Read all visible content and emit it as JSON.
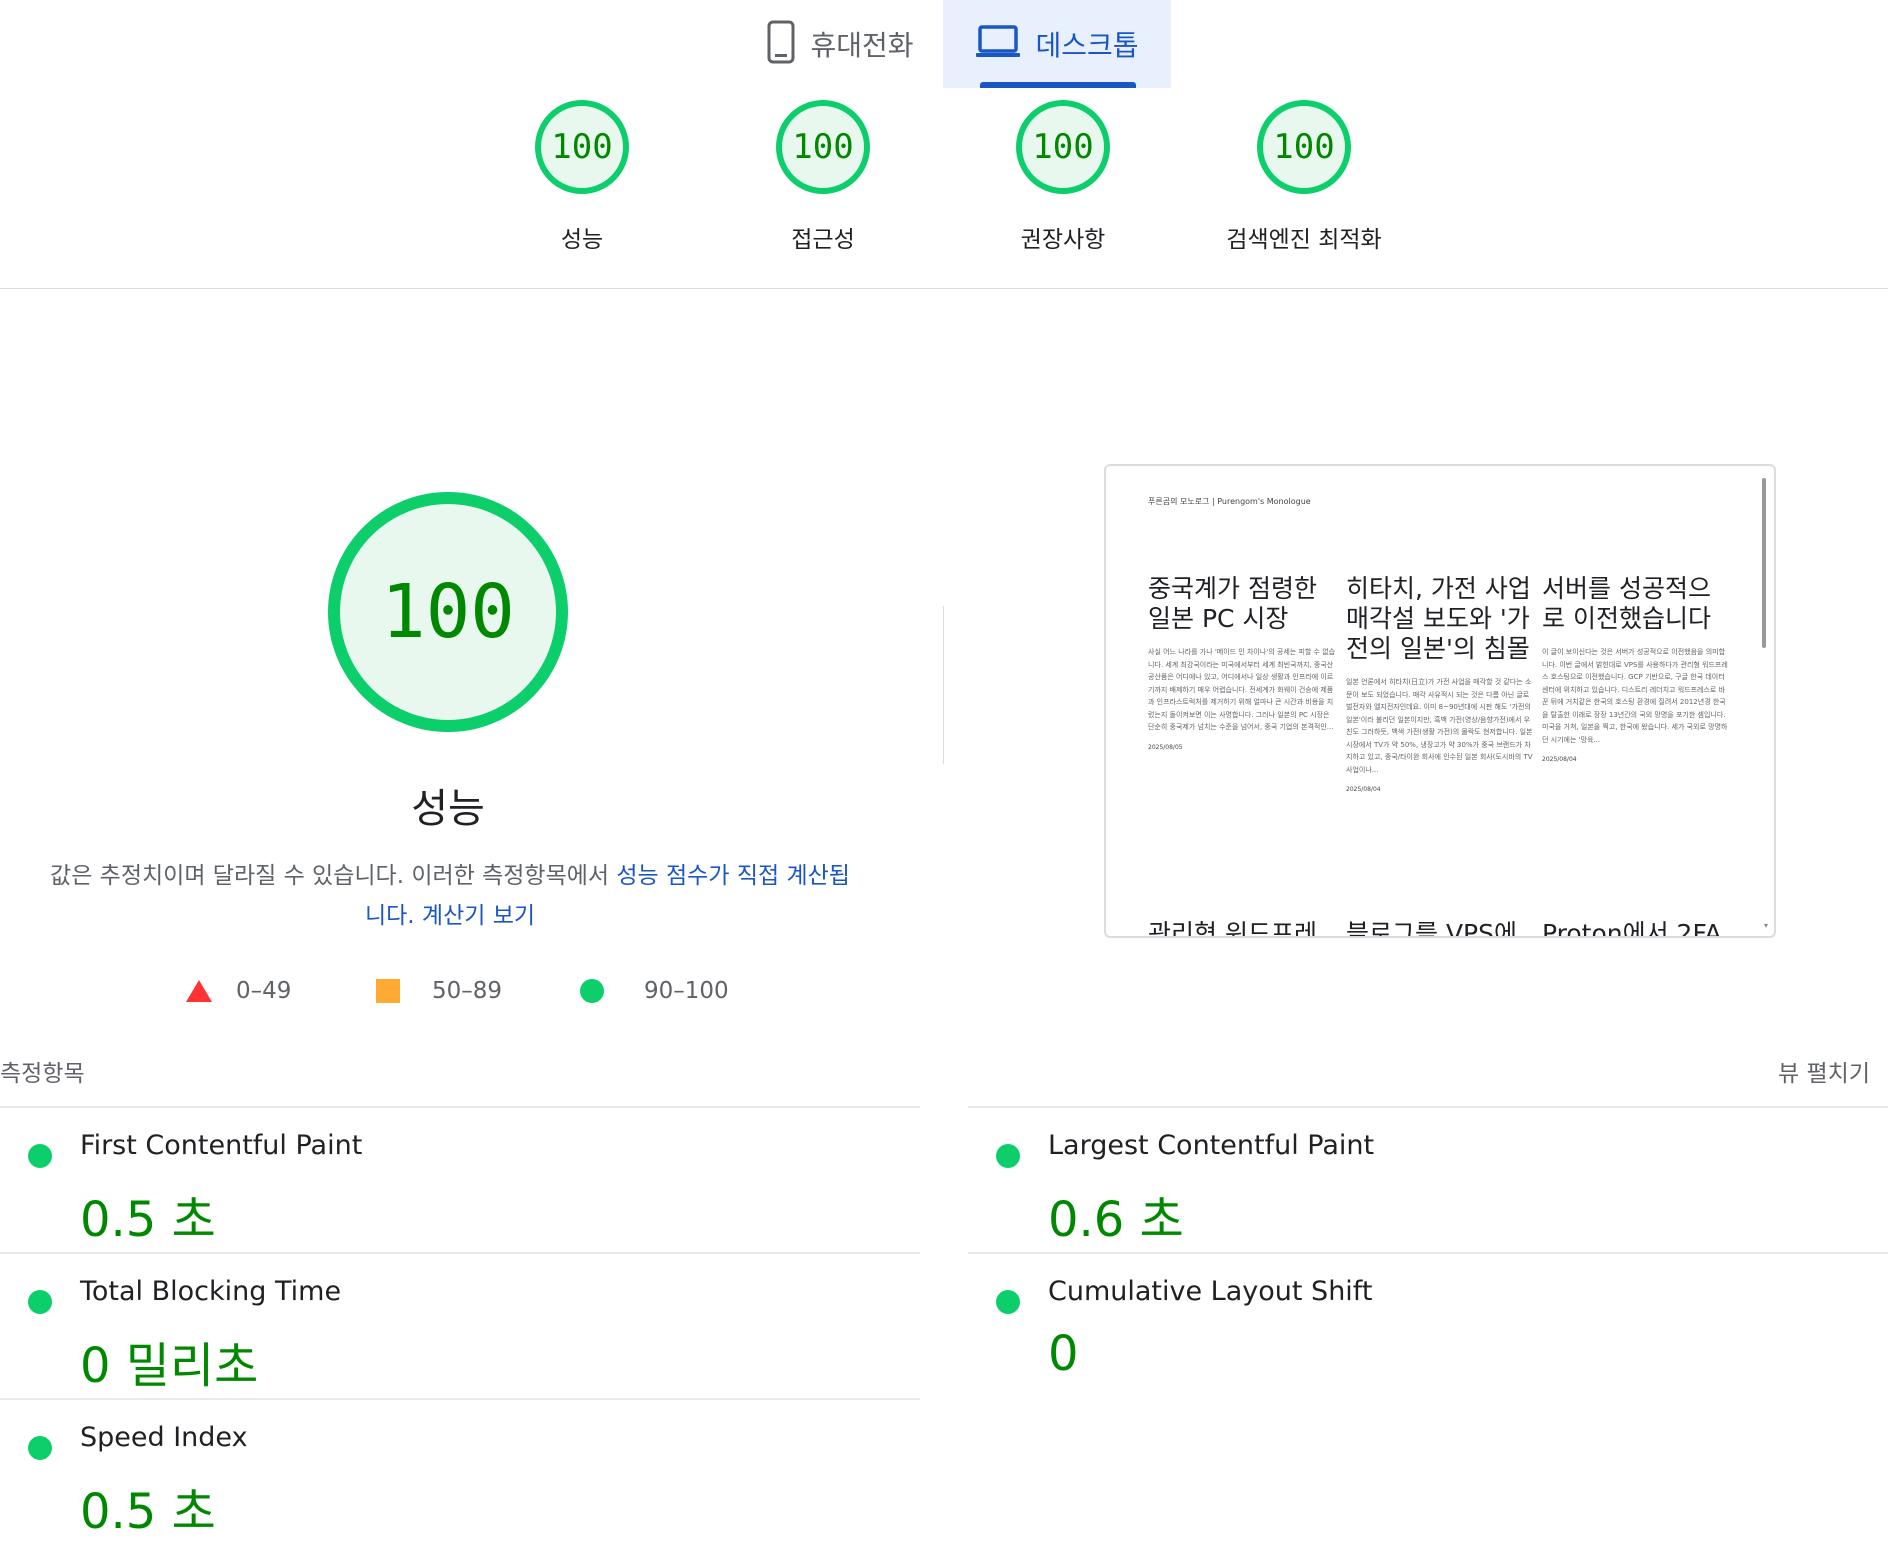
{
  "tabs": [
    {
      "label": "휴대전화",
      "icon": "phone-icon",
      "selected": false
    },
    {
      "label": "데스크톱",
      "icon": "laptop-icon",
      "selected": true
    }
  ],
  "scores": [
    {
      "label": "성능",
      "value": "100"
    },
    {
      "label": "접근성",
      "value": "100"
    },
    {
      "label": "권장사항",
      "value": "100"
    },
    {
      "label": "검색엔진 최적화",
      "value": "100"
    }
  ],
  "performance": {
    "score": "100",
    "title": "성능",
    "desc_prefix": "값은 추정치이며 달라질 수 있습니다. 이러한 측정항목에서 ",
    "desc_link1": "성능 점수가 직접 계산됩니다.",
    "desc_link2": "계산기 보기"
  },
  "legend": [
    {
      "range": "0–49",
      "shape": "triangle",
      "color": "#ff3333"
    },
    {
      "range": "50–89",
      "shape": "square",
      "color": "#ffaa33"
    },
    {
      "range": "90–100",
      "shape": "circle",
      "color": "#0cce6b"
    }
  ],
  "thumbnail": {
    "brand": "푸른곰의 모노로그 | Purengom's Monologue",
    "posts": [
      {
        "title": "중국계가 점령한 일본 PC 시장",
        "excerpt": "사실 어느 나라를 가나 '메이드 인 차이나'의 공세는 피할 수 없습니다. 세계 최강국이라는 미국에서부터 세계 최빈국까지, 중국산 공산품은 어디에나 있고, 어디에서나 일상 생활과 인프라에 이르기까지 배제하기 매우 어렵습니다. 전세계가 화웨이 건승에 제품과 인프라스트럭처를 제거하기 위해 얼마나 큰 시간과 비용을 치렀는지 돌이켜보면 이는 사명합니다. 그러나 일본의 PC 시장은 단순히 중국제가 넘치는 수준을 넘어서, 중국 기업의 본격적인...",
        "date": "2025/08/05"
      },
      {
        "title": "히타치, 가전 사업 매각설 보도와 '가전의 일본'의 침몰",
        "excerpt": "일본 언론에서 히타치(日立)가 가전 사업을 매각할 것 같다는 소문이 보도 되었습니다. 매각 사유적시 되는 것은 다름 아닌 글로벌전자와 엘지전자인데요. 이미 8~90년대에 시판 해도 '가전의 일본'이라 불리던 일본이지만, 흑백 가전(영상/음향가전)에서 우친도 그러하듯, 백색 가전(생활 가전)의 몰락도 현저합니다. 일본 시장에서 TV가 약 50%, 냉장고가 약 30%가 중국 브랜드가 차지하고 있고, 중국/타이완 회사에 인수된 일본 회사(도시바의 TV 사업이나...",
        "date": "2025/08/04"
      },
      {
        "title": "서버를 성공적으로 이전했습니다",
        "excerpt": "이 글이 보이신다는 것은 서버가 성공적으로 이전했음을 의미합니다. 이번 글에서 밝힌대로 VPS를 사용하다가 관리형 워드프레스 호스팅으로 이전했습니다. GCP 기반으로, 구글 한국 데이터센터에 위치하고 있습니다. 디스트리 레더치고 워드프레스로 바꾼 뒤에 거치같은 한국의 호스팅 환경에 질려서 2012년경 한국을 탈출한 이래로 장장 13년간의 국외 망명을 포기한 셈입니다. 미국을 거쳐, 일본을 찍고, 한국에 왔습니다. 세가 국외로 망명하던 시기에는 '망육...",
        "date": "2025/08/04"
      }
    ],
    "second_row": [
      "관리형 워드프레",
      "블로그를 VPS에",
      "Proton에서 2FA"
    ]
  },
  "metrics": {
    "title": "측정항목",
    "expand_label": "뷰 펼치기",
    "items": [
      {
        "name": "First Contentful Paint",
        "value": "0.5 초"
      },
      {
        "name": "Largest Contentful Paint",
        "value": "0.6 초"
      },
      {
        "name": "Total Blocking Time",
        "value": "0 밀리초"
      },
      {
        "name": "Cumulative Layout Shift",
        "value": "0"
      },
      {
        "name": "Speed Index",
        "value": "0.5 초"
      }
    ]
  },
  "colors": {
    "good": "#0cce6b",
    "good_text": "#008800",
    "link": "#1a56c4",
    "average": "#ffaa33",
    "poor": "#ff3333"
  }
}
